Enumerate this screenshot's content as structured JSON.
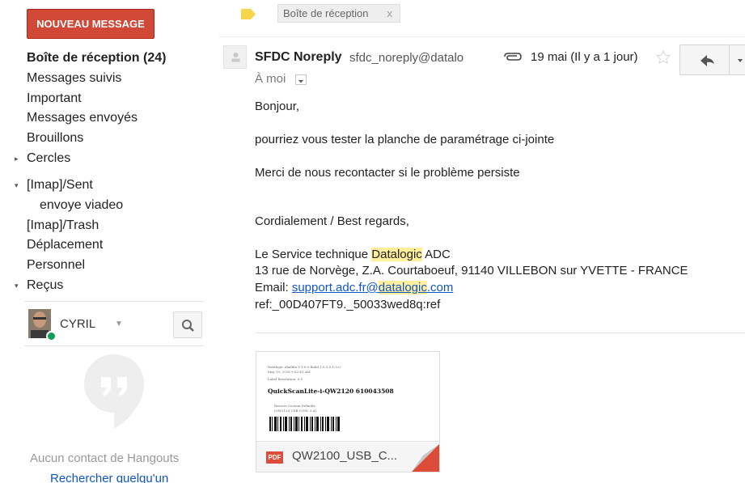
{
  "sidebar": {
    "compose_label": "NOUVEAU MESSAGE",
    "items": [
      {
        "label": "Boîte de réception (24)"
      },
      {
        "label": "Messages suivis"
      },
      {
        "label": "Important"
      },
      {
        "label": "Messages envoyés"
      },
      {
        "label": "Brouillons"
      },
      {
        "label": "Cercles"
      },
      {
        "label": "[Imap]/Sent"
      },
      {
        "label": "envoye viadeo"
      },
      {
        "label": "[Imap]/Trash"
      },
      {
        "label": "Déplacement"
      },
      {
        "label": "Personnel"
      },
      {
        "label": "Reçus"
      }
    ],
    "user_name": "CYRIL",
    "hangouts_empty": "Aucun contact de Hangouts",
    "hangouts_find": "Rechercher quelqu'un"
  },
  "label_chip": {
    "label": "Boîte de réception",
    "close": "x"
  },
  "message": {
    "sender_name": "SFDC Noreply",
    "sender_email": "sfdc_noreply@datalo",
    "date": "19 mai (Il y a 1 jour)",
    "recipient": "À moi",
    "greeting": "Bonjour,",
    "line1": "pourriez vous tester la planche de paramétrage ci-jointe",
    "line2": "Merci de nous recontacter si le problème persiste",
    "closing": "Cordialement / Best regards,",
    "sig_prefix": "Le Service technique ",
    "sig_company": "Datalogic",
    "sig_suffix": " ADC",
    "address": "13 rue de Norvège, Z.A. Courtaboeuf, 91140 VILLEBON sur YVETTE - FRANCE",
    "email_label": "Email: ",
    "email_part1": "support.adc.fr@",
    "email_part2": "datalogic",
    "email_part3": ".com",
    "ref": "ref:_00D407FT9._50033wed8q:ref"
  },
  "attachment": {
    "type_badge": "PDF",
    "file_name": "QW2100_USB_C...",
    "preview_line1": "Datalogic Aladdin V.1.0.0 Build 1.0.1.0.1.0.0",
    "preview_line2": "May 19, 2016 9:52:41 AM",
    "preview_line3": "Label Resolution: 0.5",
    "preview_title": "QuickScanLite-i-QW2120 610043508",
    "preview_line4": "Restore Custom Defaults",
    "preview_line5": "(QW2120 USB-COM, 3 A)"
  },
  "colors": {
    "compose_bg": "#d14836",
    "presence": "#0f9d58",
    "link": "#1155cc",
    "highlight": "#ffef9a",
    "label_tag": "#f6d54a"
  }
}
